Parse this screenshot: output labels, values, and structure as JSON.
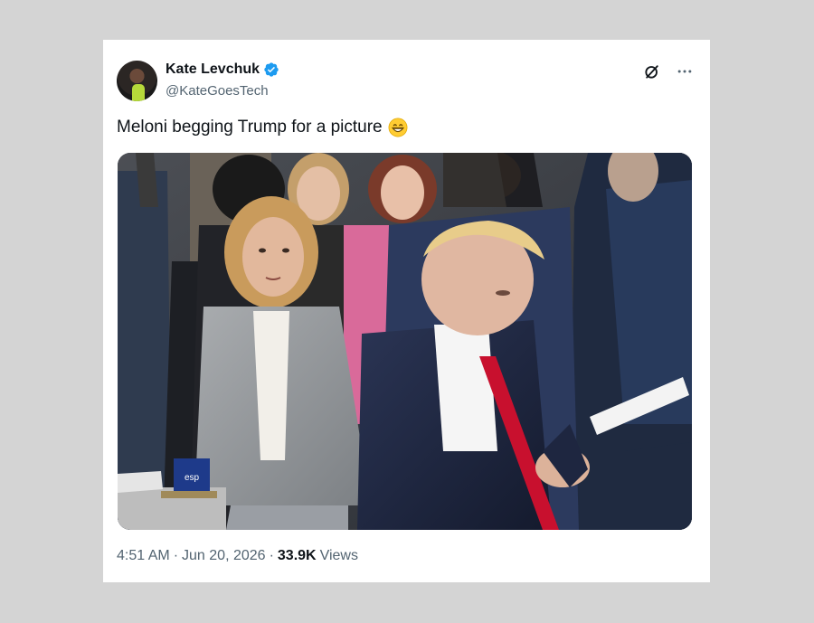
{
  "author": {
    "display_name": "Kate Levchuk",
    "handle": "@KateGoesTech",
    "verified": true,
    "verified_color": "#1d9bf0"
  },
  "tweet": {
    "text": "Meloni begging Trump for a picture",
    "emoji": "grinning-face-emoji"
  },
  "meta": {
    "time": "4:51 AM",
    "date": "Jun 20, 2026",
    "separator": "·",
    "views_count": "33.9K",
    "views_label": "Views"
  },
  "icons": {
    "grok": "grok-icon",
    "more": "more-options-icon"
  },
  "media": {
    "signage_text": "esp"
  },
  "colors": {
    "page_bg": "#d4d4d4",
    "card_bg": "#ffffff",
    "text_primary": "#0f1419",
    "text_secondary": "#536471"
  }
}
